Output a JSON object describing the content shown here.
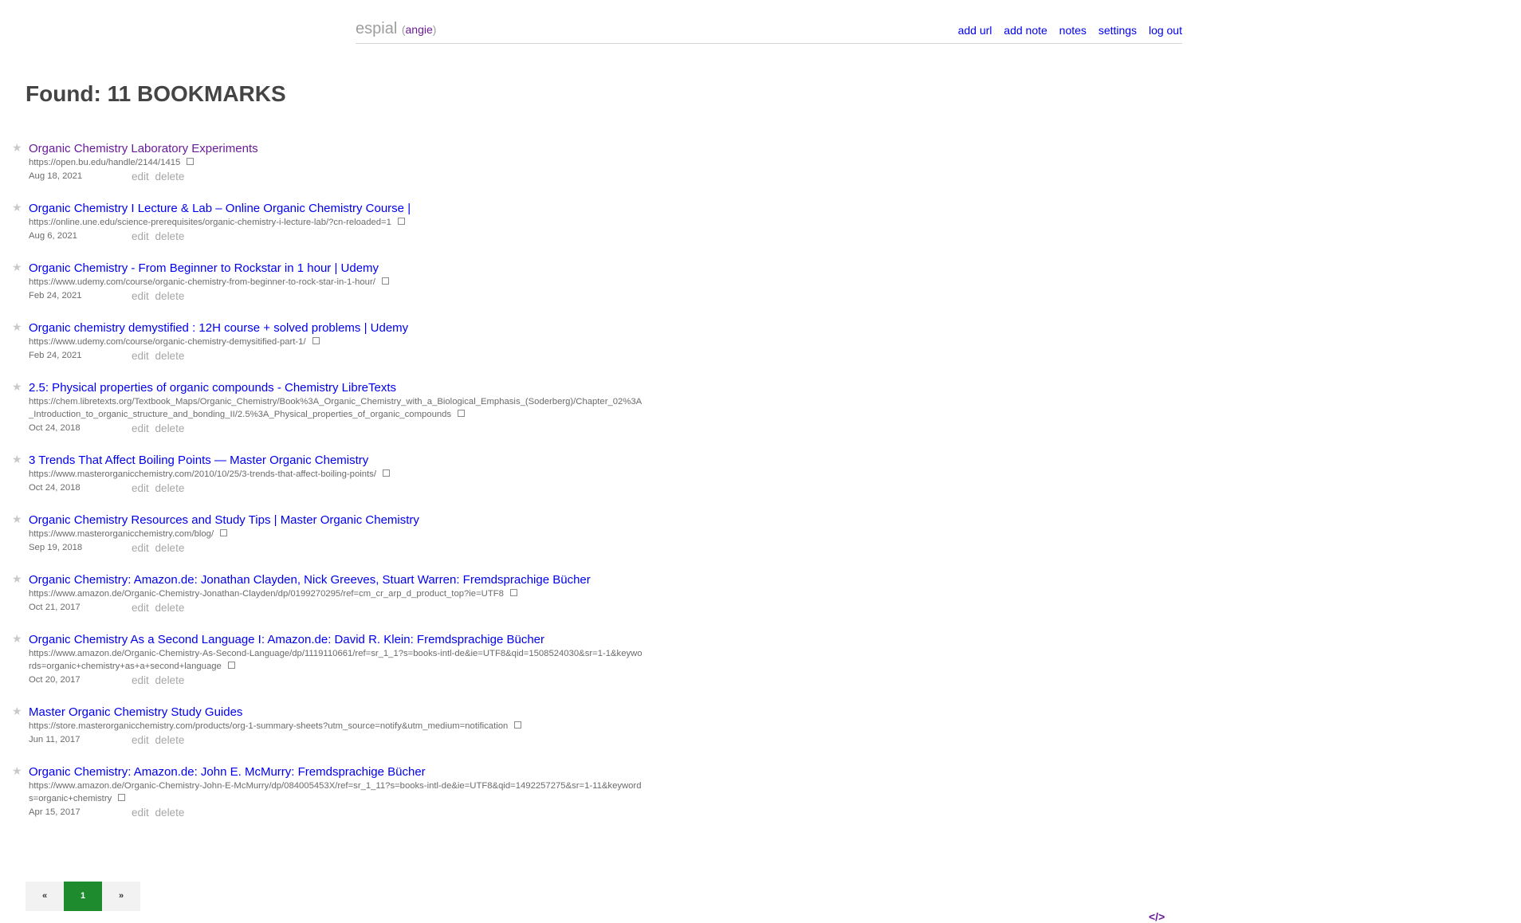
{
  "header": {
    "brand": "espial",
    "user": "angie",
    "nav": {
      "add_url": "add url",
      "add_note": "add note",
      "notes": "notes",
      "settings": "settings",
      "logout": "log out"
    }
  },
  "found": "Found: 11 BOOKMARKS",
  "icons": {
    "star": "★",
    "archive": "archive-box-icon"
  },
  "bookmarks": [
    {
      "title": "Organic Chemistry Laboratory Experiments",
      "url": "https://open.bu.edu/handle/2144/1415",
      "date": "Aug 18, 2021",
      "edit": "edit",
      "delete": "delete",
      "visited": true
    },
    {
      "title": "Organic Chemistry I Lecture & Lab – Online Organic Chemistry Course |",
      "url": "https://online.une.edu/science-prerequisites/organic-chemistry-i-lecture-lab/?cn-reloaded=1",
      "date": "Aug 6, 2021",
      "edit": "edit",
      "delete": "delete",
      "visited": false
    },
    {
      "title": "Organic Chemistry - From Beginner to Rockstar in 1 hour | Udemy",
      "url": "https://www.udemy.com/course/organic-chemistry-from-beginner-to-rock-star-in-1-hour/",
      "date": "Feb 24, 2021",
      "edit": "edit",
      "delete": "delete",
      "visited": false
    },
    {
      "title": "Organic chemistry demystified : 12H course + solved problems | Udemy",
      "url": "https://www.udemy.com/course/organic-chemistry-demysitified-part-1/",
      "date": "Feb 24, 2021",
      "edit": "edit",
      "delete": "delete",
      "visited": false
    },
    {
      "title": "2.5: Physical properties of organic compounds - Chemistry LibreTexts",
      "url": "https://chem.libretexts.org/Textbook_Maps/Organic_Chemistry/Book%3A_Organic_Chemistry_with_a_Biological_Emphasis_(Soderberg)/Chapter_02%3A_Introduction_to_organic_structure_and_bonding_II/2.5%3A_Physical_properties_of_organic_compounds",
      "date": "Oct 24, 2018",
      "edit": "edit",
      "delete": "delete",
      "visited": false
    },
    {
      "title": "3 Trends That Affect Boiling Points — Master Organic Chemistry",
      "url": "https://www.masterorganicchemistry.com/2010/10/25/3-trends-that-affect-boiling-points/",
      "date": "Oct 24, 2018",
      "edit": "edit",
      "delete": "delete",
      "visited": false
    },
    {
      "title": "Organic Chemistry Resources and Study Tips | Master Organic Chemistry",
      "url": "https://www.masterorganicchemistry.com/blog/",
      "date": "Sep 19, 2018",
      "edit": "edit",
      "delete": "delete",
      "visited": false
    },
    {
      "title": "Organic Chemistry: Amazon.de: Jonathan Clayden, Nick Greeves, Stuart Warren: Fremdsprachige Bücher",
      "url": "https://www.amazon.de/Organic-Chemistry-Jonathan-Clayden/dp/0199270295/ref=cm_cr_arp_d_product_top?ie=UTF8",
      "date": "Oct 21, 2017",
      "edit": "edit",
      "delete": "delete",
      "visited": false
    },
    {
      "title": "Organic Chemistry As a Second Language I: Amazon.de: David R. Klein: Fremdsprachige Bücher",
      "url": "https://www.amazon.de/Organic-Chemistry-As-Second-Language/dp/1119110661/ref=sr_1_1?s=books-intl-de&ie=UTF8&qid=1508524030&sr=1-1&keywords=organic+chemistry+as+a+second+language",
      "date": "Oct 20, 2017",
      "edit": "edit",
      "delete": "delete",
      "visited": false
    },
    {
      "title": "Master Organic Chemistry Study Guides",
      "url": "https://store.masterorganicchemistry.com/products/org-1-summary-sheets?utm_source=notify&utm_medium=notification",
      "date": "Jun 11, 2017",
      "edit": "edit",
      "delete": "delete",
      "visited": false
    },
    {
      "title": "Organic Chemistry: Amazon.de: John E. McMurry: Fremdsprachige Bücher",
      "url": "https://www.amazon.de/Organic-Chemistry-John-E-McMurry/dp/084005453X/ref=sr_1_11?s=books-intl-de&ie=UTF8&qid=1492257275&sr=1-11&keywords=organic+chemistry",
      "date": "Apr 15, 2017",
      "edit": "edit",
      "delete": "delete",
      "visited": false
    }
  ],
  "pagination": {
    "prev": "«",
    "current": "1",
    "next": "»"
  },
  "footer": {
    "source": "</>"
  },
  "colors": {
    "link": "#0000ee",
    "visited": "#6a1b9a",
    "pager_active": "#1e8c2e",
    "muted": "#a6a6a6"
  }
}
